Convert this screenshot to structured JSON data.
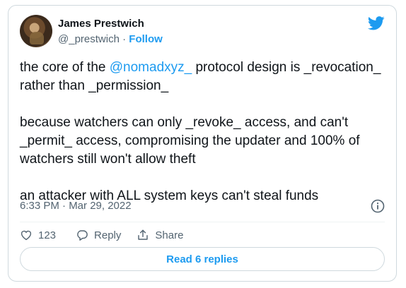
{
  "author": {
    "name": "James Prestwich",
    "handle": "@_prestwich",
    "separator": "·",
    "follow_label": "Follow"
  },
  "tweet": {
    "line1_prefix": "the core of the ",
    "mention": "@nomadxyz_",
    "line1_suffix": " protocol design is _revocation_ rather than _permission_",
    "paragraph2": "because watchers can only _revoke_ access, and can't _permit_ access, compromising the updater and 100% of watchers still won't allow theft",
    "paragraph3": "an attacker with ALL system keys can't steal funds"
  },
  "meta": {
    "timestamp": "6:33 PM · Mar 29, 2022"
  },
  "actions": {
    "likes_count": "123",
    "reply_label": "Reply",
    "share_label": "Share"
  },
  "read_replies_label": "Read 6 replies",
  "colors": {
    "accent": "#1d9bf0",
    "text": "#0f1419",
    "muted": "#536471",
    "border": "#cfd9de"
  },
  "icons": [
    "twitter-bird-icon",
    "info-icon",
    "heart-icon",
    "reply-icon",
    "share-icon"
  ]
}
